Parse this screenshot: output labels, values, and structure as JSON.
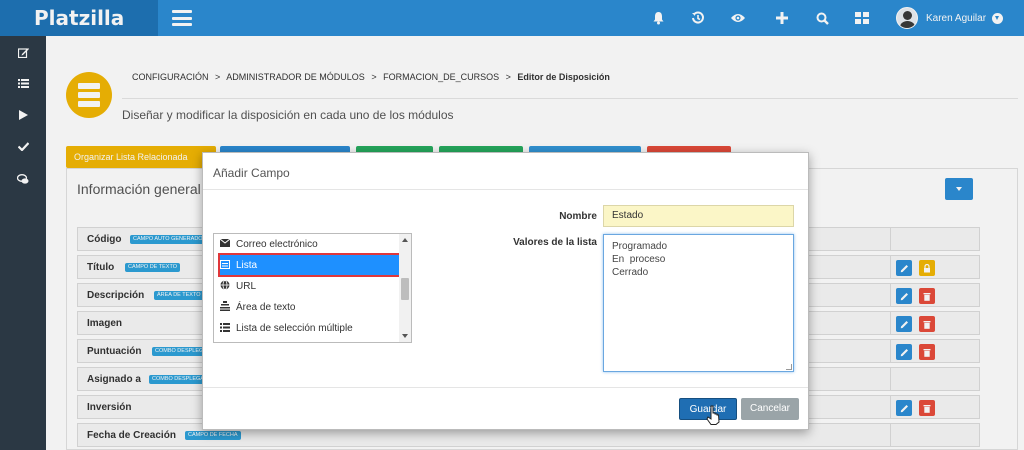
{
  "topbar": {
    "brand": "Platzilla",
    "icons": [
      "menu-icon",
      "bell-icon",
      "history-icon",
      "eye-icon",
      "plus-icon",
      "search-icon",
      "grid-icon"
    ],
    "user_name": "Karen Aguilar",
    "accent": "#2d8ed6",
    "brand_bg": "#1f74b8"
  },
  "sidebar": {
    "items": [
      "edit-icon",
      "list-icon",
      "play-icon",
      "check-icon",
      "chat-icon"
    ],
    "bg": "#2e3b48"
  },
  "breadcrumb": {
    "items": [
      "CONFIGURACIÓN",
      "ADMINISTRADOR DE MÓDULOS",
      "FORMACION_DE_CURSOS"
    ],
    "current": "Editor de Disposición"
  },
  "page": {
    "subtitle": "Diseñar y modificar la disposición en cada uno de los módulos",
    "first_tab_label": "Organizar Lista Relacionada",
    "tab_colors": [
      "#f2b705",
      "#2d8ed6",
      "#27ae60",
      "#27ae60",
      "#3498db",
      "#e74c3c"
    ]
  },
  "section": {
    "title": "Información general",
    "fields": [
      {
        "name": "Código",
        "tag": "CAMPO AUTO GENERADO"
      },
      {
        "name": "Título",
        "tag": "CAMPO DE TEXTO"
      },
      {
        "name": "Descripción",
        "tag": "ÁREA DE TEXTO"
      },
      {
        "name": "Imagen",
        "tag": ""
      },
      {
        "name": "Puntuación",
        "tag": "COMBO DESPLEGABLE"
      },
      {
        "name": "Asignado a",
        "tag": "COMBO DESPLEGABLE"
      },
      {
        "name": "Inversión",
        "tag": ""
      },
      {
        "name": "Fecha de Creación",
        "tag": "CAMPO DE FECHA"
      }
    ]
  },
  "modal": {
    "title": "Añadir Campo",
    "field_types": [
      "Correo electrónico",
      "Lista",
      "URL",
      "Área de texto",
      "Lista de selección múltiple"
    ],
    "selected_type": "Lista",
    "nombre_label": "Nombre",
    "nombre_value": "Estado",
    "valores_label": "Valores de la lista",
    "valores_value": "Programado\nEn  proceso\nCerrado",
    "save_label": "Guardar",
    "cancel_label": "Cancelar"
  }
}
